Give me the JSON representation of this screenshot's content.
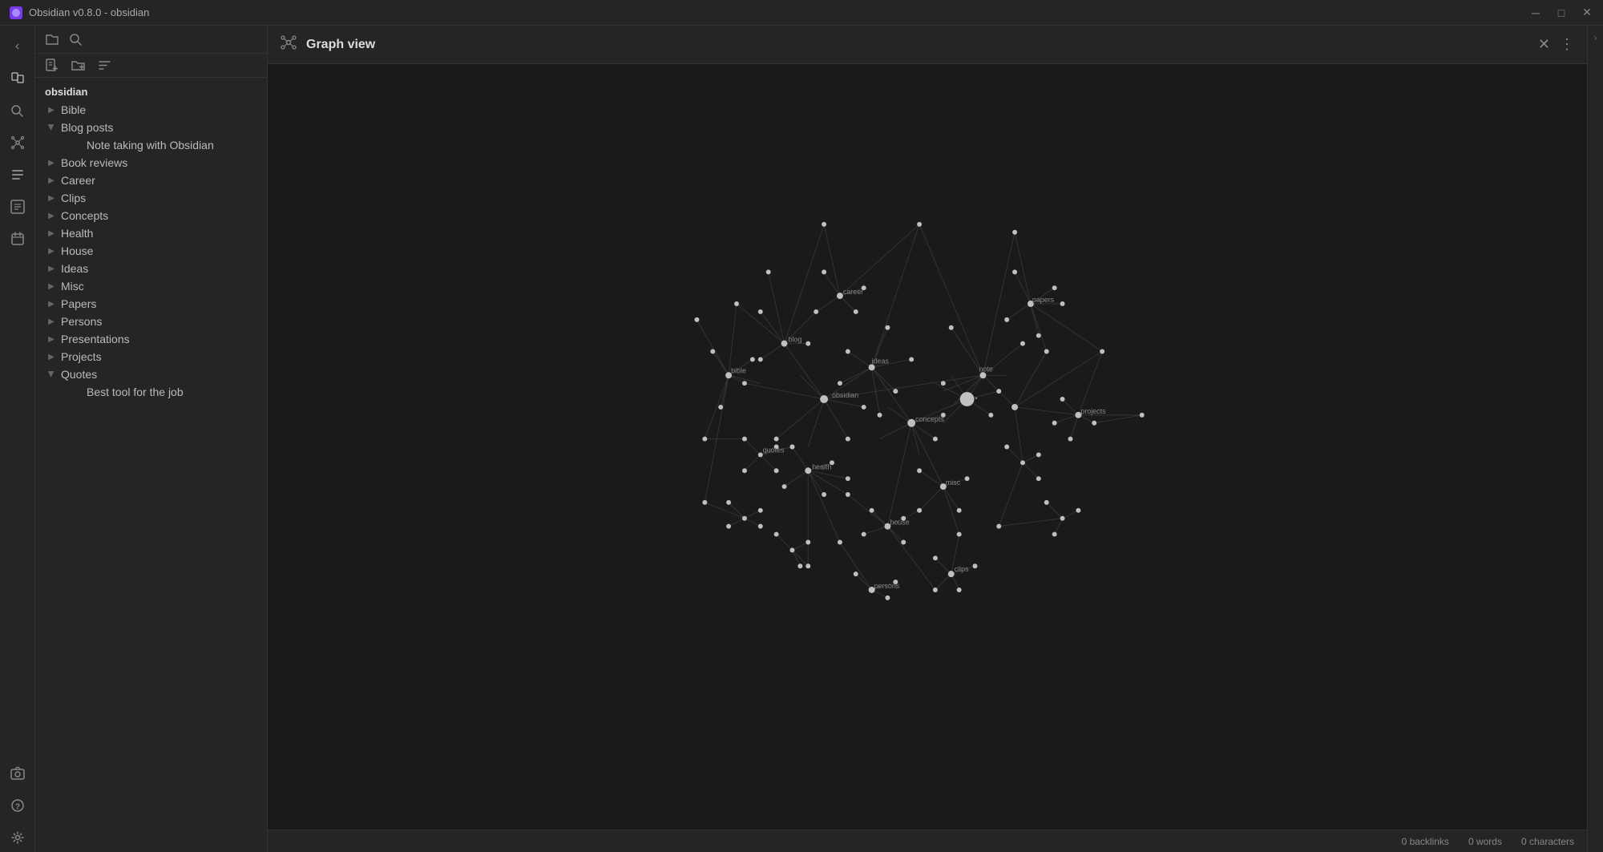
{
  "titlebar": {
    "title": "Obsidian v0.8.0 - obsidian",
    "icon": "◆"
  },
  "sidebar": {
    "vault_name": "obsidian",
    "tree_items": [
      {
        "id": "bible",
        "label": "Bible",
        "expanded": false,
        "level": 0
      },
      {
        "id": "blog-posts",
        "label": "Blog posts",
        "expanded": true,
        "level": 0
      },
      {
        "id": "note-taking",
        "label": "Note taking with Obsidian",
        "expanded": false,
        "level": 1
      },
      {
        "id": "book-reviews",
        "label": "Book reviews",
        "expanded": false,
        "level": 0
      },
      {
        "id": "career",
        "label": "Career",
        "expanded": false,
        "level": 0
      },
      {
        "id": "clips",
        "label": "Clips",
        "expanded": false,
        "level": 0
      },
      {
        "id": "concepts",
        "label": "Concepts",
        "expanded": false,
        "level": 0
      },
      {
        "id": "health",
        "label": "Health",
        "expanded": false,
        "level": 0
      },
      {
        "id": "house",
        "label": "House",
        "expanded": false,
        "level": 0
      },
      {
        "id": "ideas",
        "label": "Ideas",
        "expanded": false,
        "level": 0
      },
      {
        "id": "misc",
        "label": "Misc",
        "expanded": false,
        "level": 0
      },
      {
        "id": "papers",
        "label": "Papers",
        "expanded": false,
        "level": 0
      },
      {
        "id": "persons",
        "label": "Persons",
        "expanded": false,
        "level": 0
      },
      {
        "id": "presentations",
        "label": "Presentations",
        "expanded": false,
        "level": 0
      },
      {
        "id": "projects",
        "label": "Projects",
        "expanded": false,
        "level": 0
      },
      {
        "id": "quotes",
        "label": "Quotes",
        "expanded": true,
        "level": 0
      },
      {
        "id": "best-tool",
        "label": "Best tool for the job",
        "expanded": false,
        "level": 1
      }
    ]
  },
  "graph": {
    "title": "Graph view",
    "icon": "⬡"
  },
  "status_bar": {
    "backlinks": "0 backlinks",
    "words": "0 words",
    "characters": "0 characters"
  },
  "icons": {
    "folder": "📁",
    "search": "🔍",
    "new_note": "📄",
    "new_folder": "📁",
    "sort": "⇅",
    "files": "📋",
    "graph": "⬡",
    "table": "⊞",
    "tag": "🏷",
    "daily": "📅",
    "command": "⌘",
    "settings": "⚙",
    "help": "?",
    "back": "‹",
    "close": "✕",
    "more": "⋮"
  }
}
